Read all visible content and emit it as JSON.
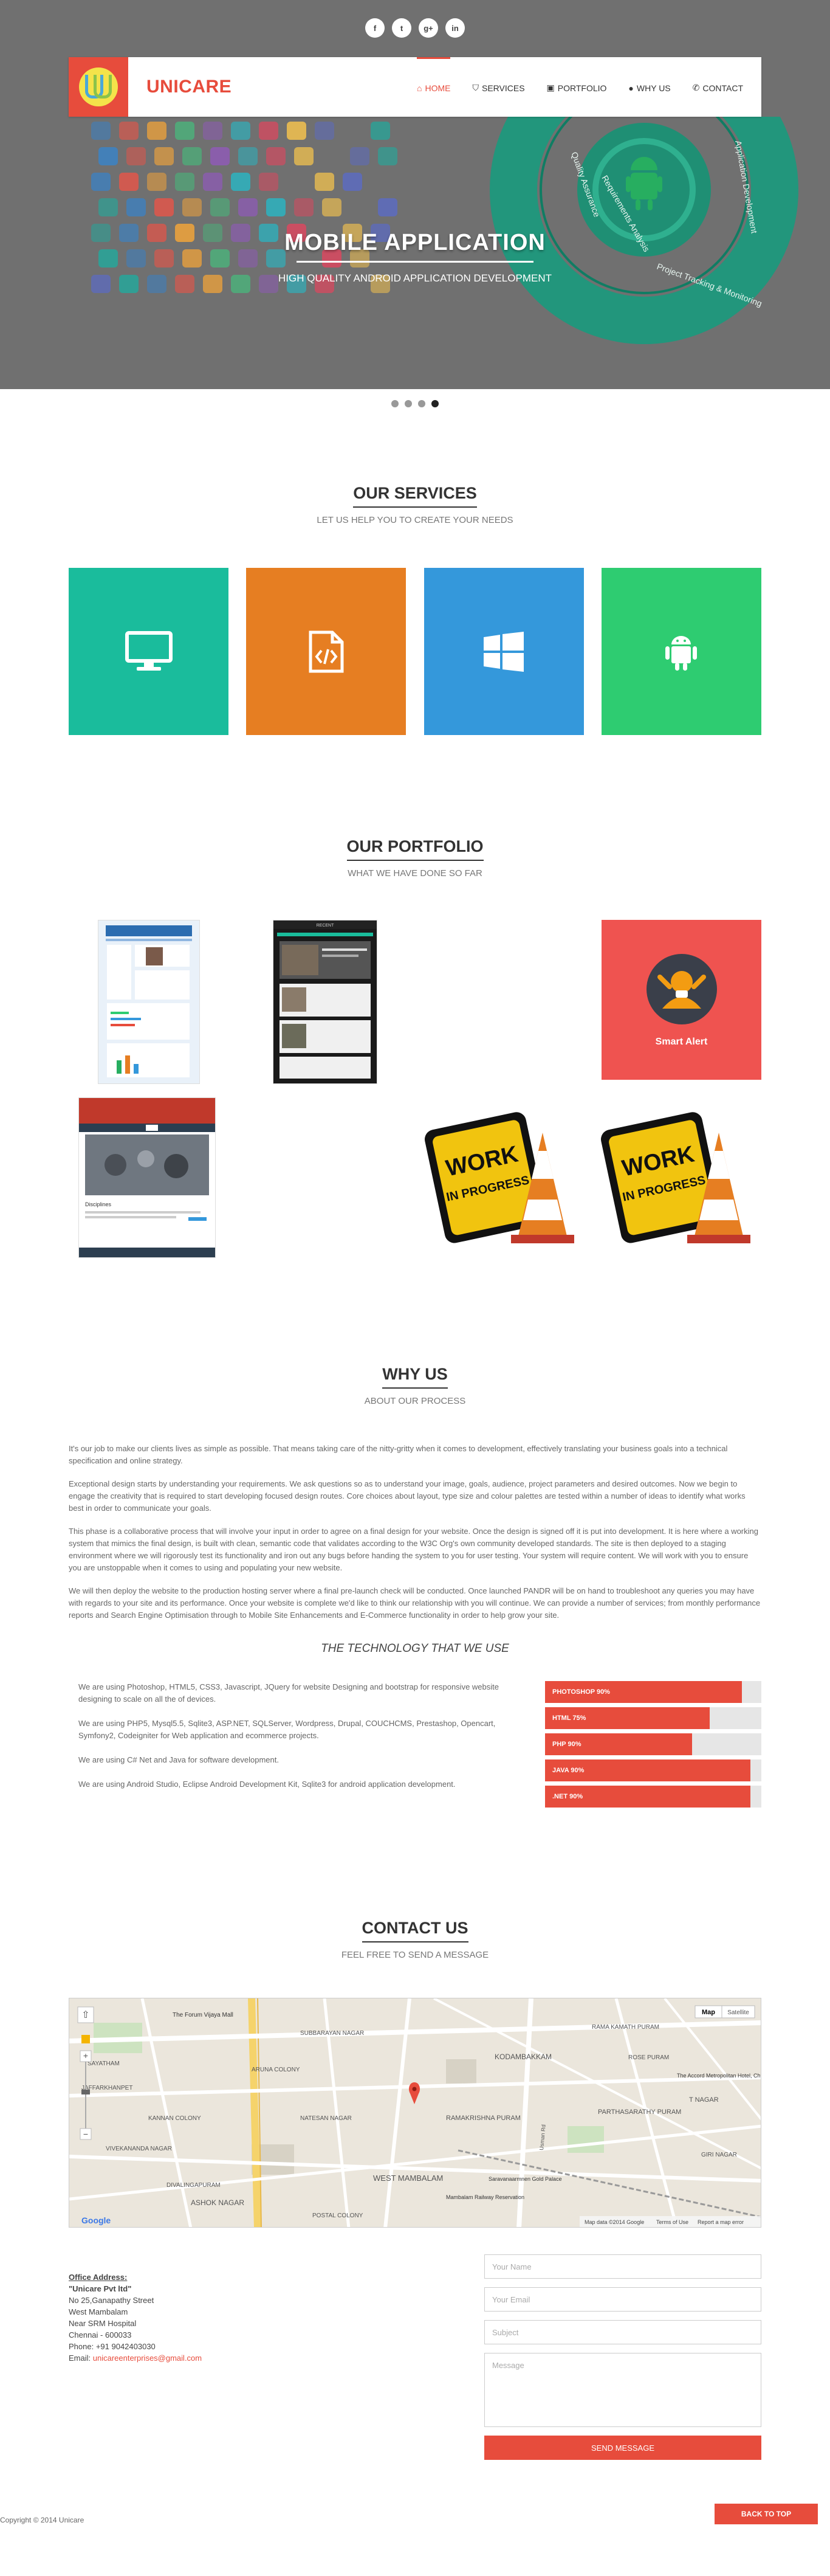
{
  "social": [
    {
      "label": "f",
      "icon": "facebook-icon"
    },
    {
      "label": "t",
      "icon": "twitter-icon"
    },
    {
      "label": "g+",
      "icon": "google-plus-icon"
    },
    {
      "label": "in",
      "icon": "linkedin-icon"
    }
  ],
  "brand": "UNICARE",
  "nav": [
    {
      "label": "HOME",
      "icon": "home-icon",
      "active": true
    },
    {
      "label": "SERVICES",
      "icon": "shield-icon",
      "active": false
    },
    {
      "label": "PORTFOLIO",
      "icon": "briefcase-icon",
      "active": false
    },
    {
      "label": "WHY US",
      "icon": "user-icon",
      "active": false
    },
    {
      "label": "CONTACT",
      "icon": "phone-icon",
      "active": false
    }
  ],
  "hero": {
    "title": "MOBILE APPLICATION",
    "subtitle": "HIGH QUALITY ANDROID APPLICATION DEVELOPMENT",
    "ring_labels": [
      "Requirements Analysis",
      "Application Development",
      "Project Tracking & Monitoring",
      "Quality Assurance"
    ]
  },
  "services": {
    "title": "OUR SERVICES",
    "subtitle": "LET US HELP YOU TO CREATE YOUR NEEDS",
    "boxes": [
      {
        "icon": "monitor-icon",
        "color": "#1abc9c"
      },
      {
        "icon": "code-file-icon",
        "color": "#e67e22"
      },
      {
        "icon": "windows-icon",
        "color": "#3498db"
      },
      {
        "icon": "android-icon",
        "color": "#2ecc71"
      }
    ]
  },
  "portfolio": {
    "title": "OUR PORTFOLIO",
    "subtitle": "WHAT WE HAVE DONE SO FAR",
    "smart_alert": "Smart Alert",
    "wip_line1": "WORK",
    "wip_line2": "IN PROGRESS",
    "thumb_header": "RECENT",
    "thumb_site": "Disciplines"
  },
  "whyus": {
    "title": "WHY US",
    "subtitle": "ABOUT OUR PROCESS",
    "paragraphs": [
      "It's our job to make our clients lives as simple as possible. That means taking care of the nitty-gritty when it comes to development, effectively translating your business goals into a technical specification and online strategy.",
      "Exceptional design starts by understanding your requirements. We ask questions so as to understand your image, goals, audience, project parameters and desired outcomes. Now we begin to engage the creativity that is required to start developing focused design routes. Core choices about layout, type size and colour palettes are tested within a number of ideas to identify what works best in order to communicate your goals.",
      "This phase is a collaborative process that will involve your input in order to agree on a final design for your website. Once the design is signed off it is put into development. It is here where a working system that mimics the final design, is built with clean, semantic code that validates according to the W3C Org's own community developed standards. The site is then deployed to a staging environment where we will rigorously test its functionality and iron out any bugs before handing the system to you for user testing. Your system will require content. We will work with you to ensure you are unstoppable when it comes to using and populating your new website.",
      "We will then deploy the website to the production hosting server where a final pre-launch check will be conducted. Once launched PANDR will be on hand to troubleshoot any queries you may have with regards to your site and its performance. Once your website is complete we'd like to think our relationship with you will continue. We can provide a number of services; from monthly performance reports and Search Engine Optimisation through to Mobile Site Enhancements and E-Commerce functionality in order to help grow your site."
    ],
    "tech_title": "THE TECHNOLOGY THAT WE USE",
    "tech_text": [
      "We are using Photoshop, HTML5, CSS3, Javascript, JQuery for website Designing and bootstrap for responsive website designing to scale on all the of devices.",
      "We are using PHP5, Mysql5.5, Sqlite3, ASP.NET, SQLServer, Wordpress, Drupal, COUCHCMS, Prestashop, Opencart, Symfony2, Codeigniter for Web application and ecommerce projects.",
      "We are using C# Net and Java for software development.",
      "We are using Android Studio, Eclipse Android Development Kit, Sqlite3 for android application development."
    ],
    "skills": [
      {
        "label": "PHOTOSHOP 90%",
        "value": 0.91
      },
      {
        "label": "HTML 75%",
        "value": 0.76
      },
      {
        "label": "PHP 90%",
        "value": 0.68
      },
      {
        "label": "JAVA 90%",
        "value": 0.95
      },
      {
        "label": ".NET 90%",
        "value": 0.95
      }
    ]
  },
  "contact": {
    "title": "CONTACT US",
    "subtitle": "FEEL FREE TO SEND A MESSAGE",
    "map": {
      "type_map": "Map",
      "type_sat": "Satellite",
      "footer_data": "Map data ©2014 Google",
      "footer_terms": "Terms of Use",
      "footer_report": "Report a map error",
      "labels": [
        "The Forum Vijaya Mall",
        "SUBBARAYAN NAGAR",
        "RAMA KAMATH PURAM",
        "KODAMBAKKAM",
        "SAYATHAM",
        "JAFFARKHANPET",
        "NATESAN NAGAR",
        "RAMAKRISHNA PURAM",
        "PARTHASARATHY PURAM",
        "WEST MAMBALAM",
        "ASHOK NAGAR",
        "Saravanaarmnen Gold Palace",
        "Mambalam Railway Reservation",
        "The Accord Metropolitan Hotel, Chennai",
        "T NAGAR",
        "GIRI NAGAR",
        "ARUNA COLONY",
        "DIVALINGAPURAM",
        "POSTAL COLONY",
        "VIVEKANANDA NAGAR",
        "Usman Rd",
        "KANNAN COLONY",
        "ROSE PURAM"
      ]
    },
    "address": {
      "label": "Office Address:",
      "company": "\"Unicare Pvt ltd\"",
      "line1": "No 25,Ganapathy Street",
      "line2": "West Mambalam",
      "line3": "Near SRM Hospital",
      "line4": "Chennai - 600033",
      "phone": "Phone: +91 9042403030",
      "email_label": "Email: ",
      "email": "unicareenterprises@gmail.com"
    },
    "form": {
      "name": "Your Name",
      "email": "Your Email",
      "subject": "Subject",
      "message": "Message",
      "send": "SEND MESSAGE"
    }
  },
  "footer": {
    "copyright": "Copyright © 2014 Unicare",
    "back_to_top": "BACK TO TOP"
  }
}
